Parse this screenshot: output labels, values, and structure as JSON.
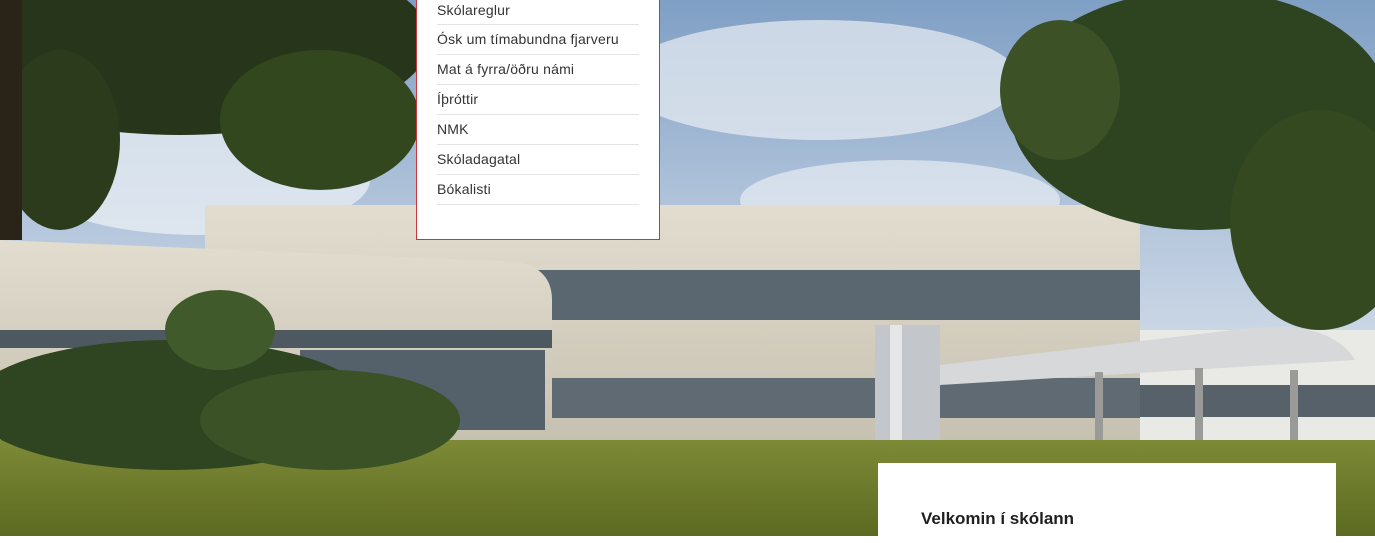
{
  "nav_menu": {
    "items": [
      {
        "label": "Skólareglur"
      },
      {
        "label": "Ósk um tímabundna fjarveru"
      },
      {
        "label": "Mat á fyrra/öðru námi"
      },
      {
        "label": "Íþróttir"
      },
      {
        "label": "NMK"
      },
      {
        "label": "Skóladagatal"
      },
      {
        "label": "Bókalisti"
      }
    ]
  },
  "welcome": {
    "heading": "Velkomin í skólann"
  },
  "colors": {
    "accent": "#c8363a",
    "sky": "#9fb7d3",
    "grass": "#6c7b2c",
    "building": "#d8d3c4"
  }
}
